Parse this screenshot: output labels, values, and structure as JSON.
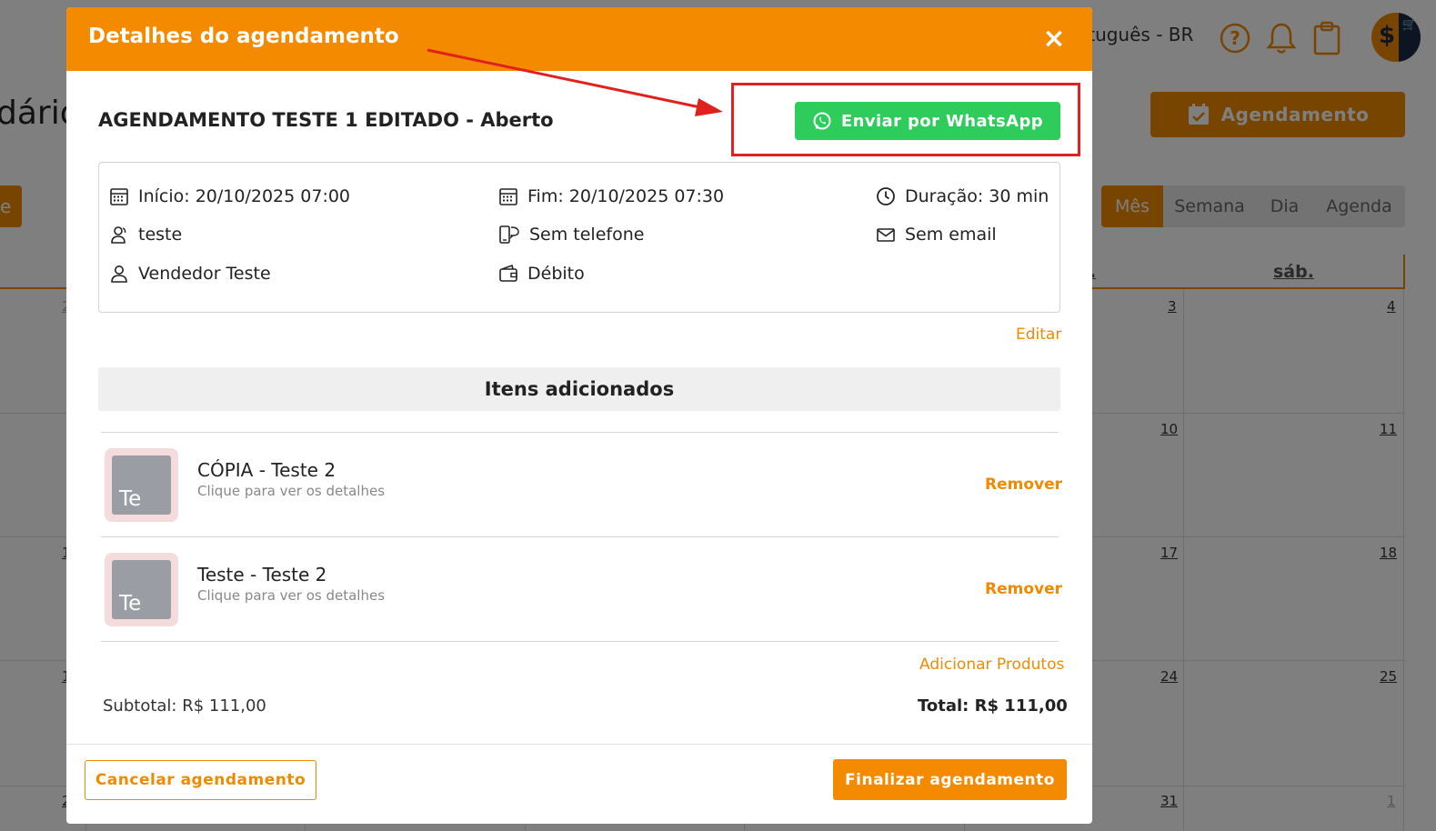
{
  "background": {
    "language": "rtuguês - BR",
    "page_title": "dário",
    "left_button_fragment": "e",
    "agendamento_button": "Agendamento",
    "view_tabs": [
      {
        "label": "Mês",
        "active": true
      },
      {
        "label": "Semana",
        "active": false
      },
      {
        "label": "Dia",
        "active": false
      },
      {
        "label": "Agenda",
        "active": false
      }
    ],
    "dow_fragment": ".",
    "dow_sab": "sáb.",
    "days": [
      {
        "label": "2",
        "muted": true
      },
      {
        "label": "3",
        "muted": false
      },
      {
        "label": "4",
        "muted": false
      },
      {
        "label": "10",
        "muted": false
      },
      {
        "label": "11",
        "muted": false
      },
      {
        "label": "1",
        "muted": false
      },
      {
        "label": "17",
        "muted": false
      },
      {
        "label": "18",
        "muted": false
      },
      {
        "label": "1",
        "muted": false
      },
      {
        "label": "24",
        "muted": false
      },
      {
        "label": "25",
        "muted": false
      },
      {
        "label": "2",
        "muted": false
      },
      {
        "label": "31",
        "muted": false
      },
      {
        "label": "1",
        "muted": true
      }
    ]
  },
  "modal": {
    "title": "Detalhes do agendamento",
    "close_label": "×",
    "appointment_title": "AGENDAMENTO TESTE 1 EDITADO - Aberto",
    "whatsapp_label": "Enviar por WhatsApp",
    "info": {
      "start": "Início: 20/10/2025 07:00",
      "end": "Fim: 20/10/2025 07:30",
      "duration": "Duração: 30 min",
      "client": "teste",
      "phone": "Sem telefone",
      "email": "Sem email",
      "seller": "Vendedor Teste",
      "payment": "Débito"
    },
    "edit_label": "Editar",
    "items_header": "Itens adicionados",
    "items": [
      {
        "thumb": "Te",
        "name": "CÓPIA - Teste 2",
        "sub": "Clique para ver os detalhes",
        "remove": "Remover"
      },
      {
        "thumb": "Te",
        "name": "Teste - Teste 2",
        "sub": "Clique para ver os detalhes",
        "remove": "Remover"
      }
    ],
    "add_products_label": "Adicionar Produtos",
    "subtotal": "Subtotal: R$ 111,00",
    "total": "Total: R$ 111,00",
    "cancel_label": "Cancelar agendamento",
    "finish_label": "Finalizar agendamento"
  },
  "colors": {
    "brand_orange": "#f38a00",
    "whatsapp_green": "#2ecc5b",
    "annotation_red": "#e0211e"
  }
}
